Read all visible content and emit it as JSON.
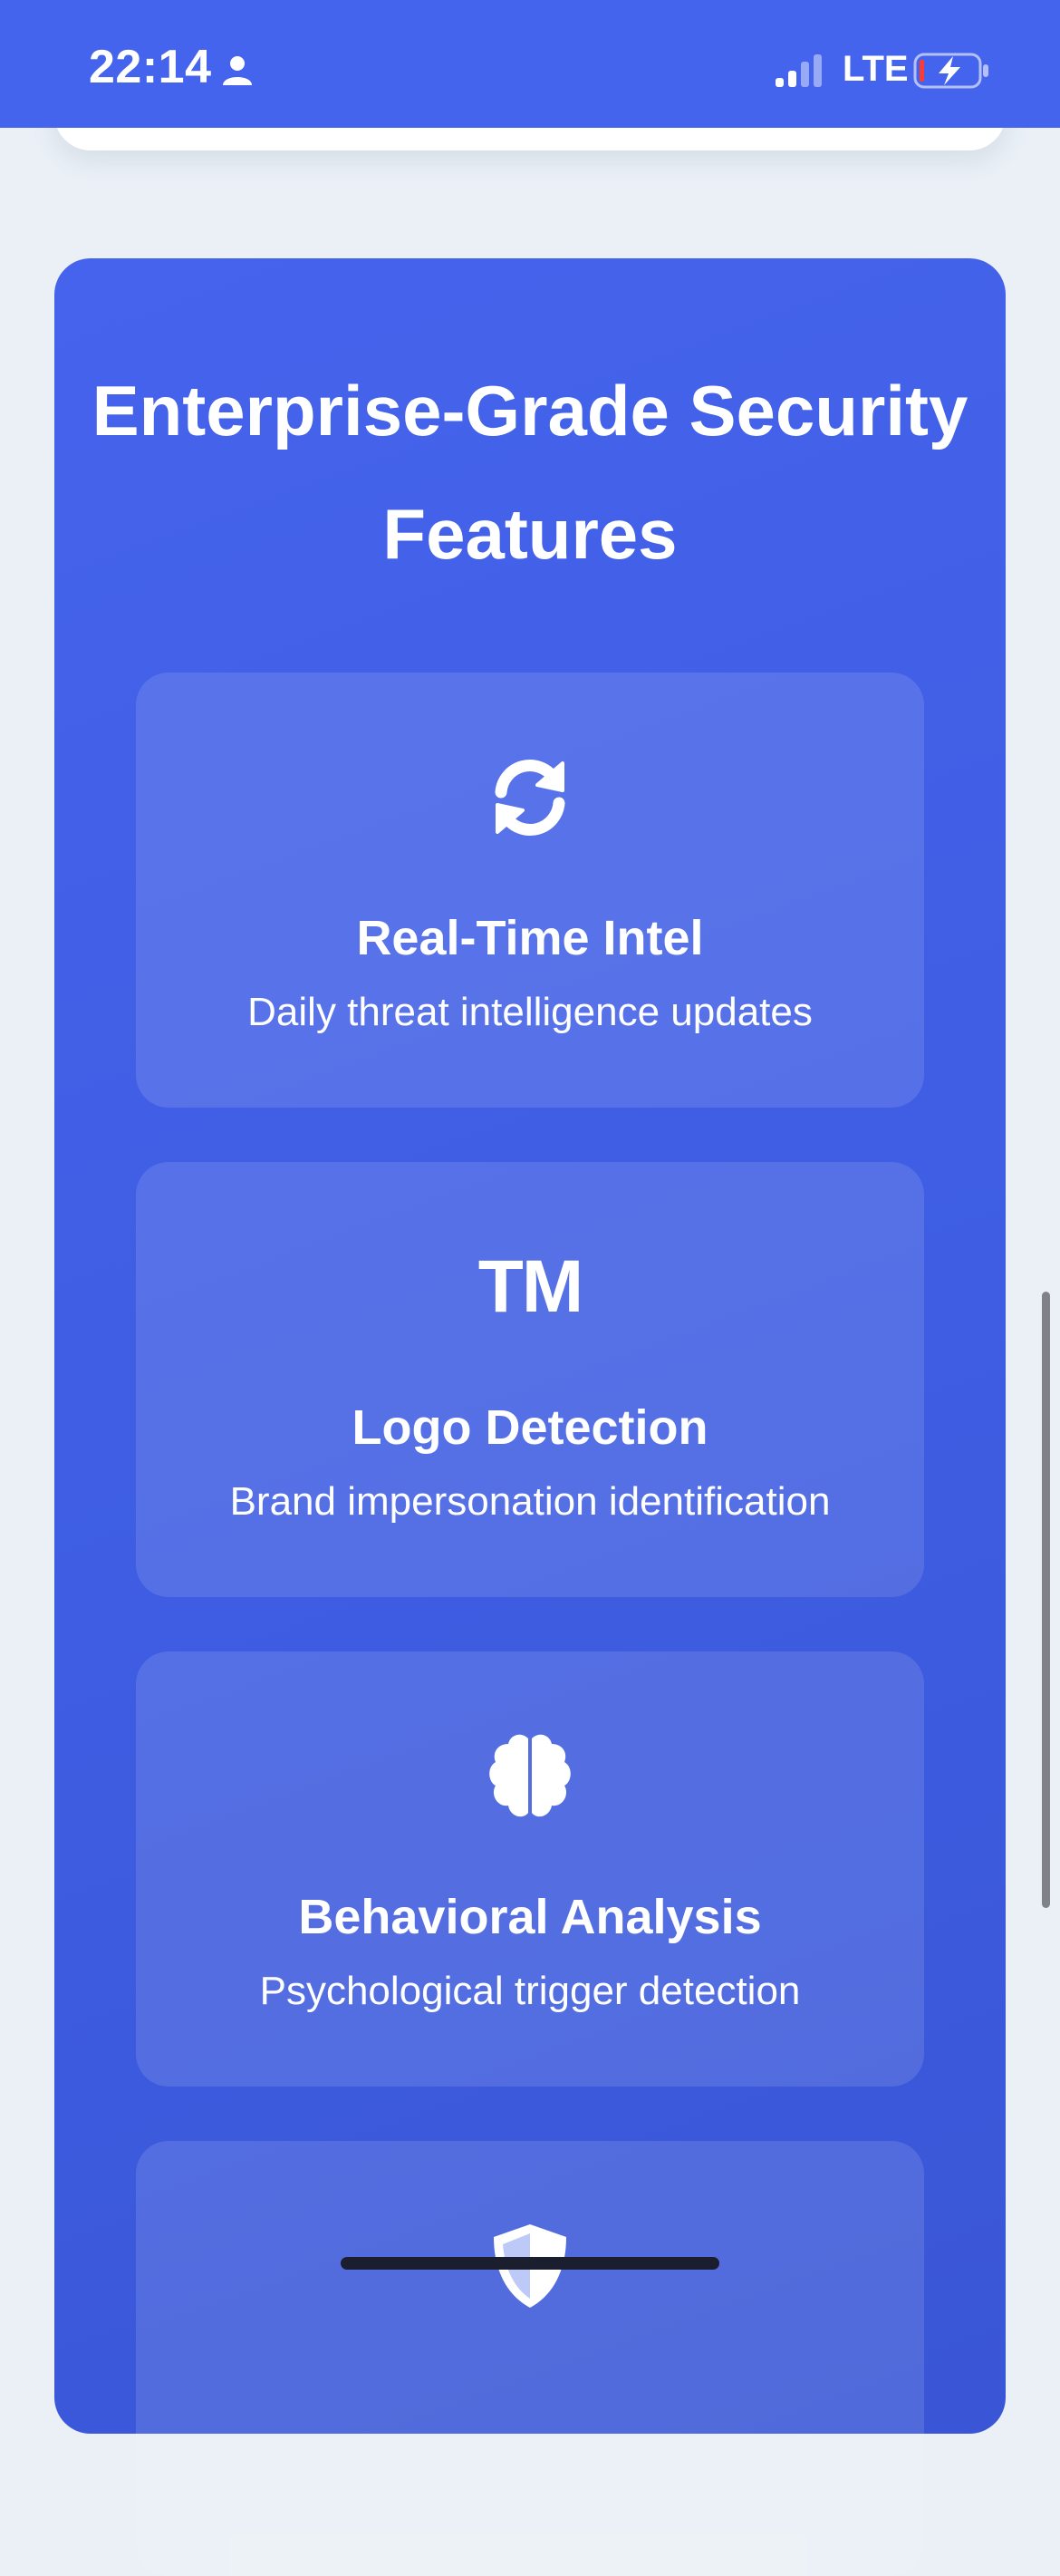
{
  "status_bar": {
    "time": "22:14",
    "network": "LTE",
    "icons": [
      "person-icon",
      "signal-icon",
      "battery-charging-icon"
    ],
    "background": "#4464ee"
  },
  "features": {
    "title": "Enterprise-Grade Security Features",
    "background": "#4263e8",
    "items": [
      {
        "icon": "refresh-icon",
        "title": "Real-Time Intel",
        "description": "Daily threat intelligence updates"
      },
      {
        "icon": "trademark-icon",
        "icon_text": "TM",
        "title": "Logo Detection",
        "description": "Brand impersonation identification"
      },
      {
        "icon": "brain-icon",
        "title": "Behavioral Analysis",
        "description": "Psychological trigger detection"
      },
      {
        "icon": "shield-icon",
        "title": "",
        "description": ""
      }
    ]
  }
}
